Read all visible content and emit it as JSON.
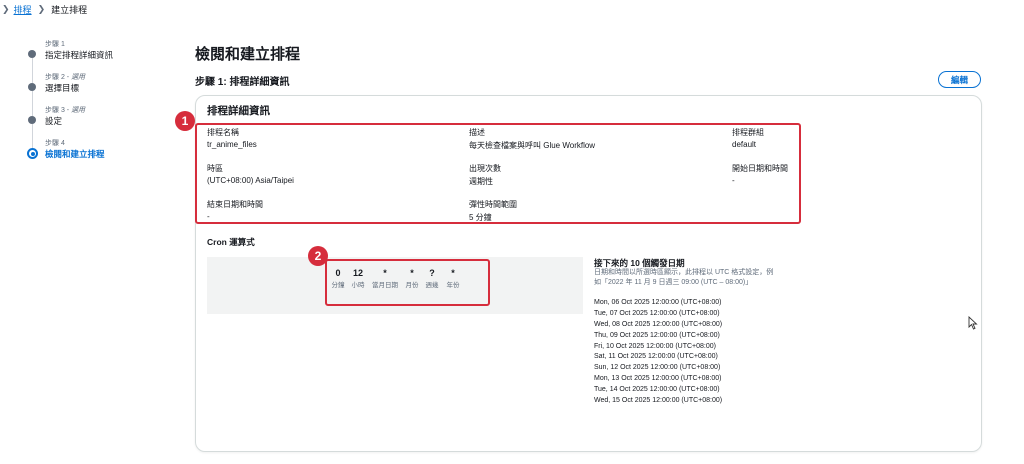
{
  "breadcrumb": {
    "root": "排程",
    "current": "建立排程"
  },
  "steps": [
    {
      "small": "步驟 1",
      "optional": "",
      "label": "指定排程詳細資訊"
    },
    {
      "small": "步驟 2 - ",
      "optional": "選用",
      "label": "選擇目標"
    },
    {
      "small": "步驟 3 - ",
      "optional": "選用",
      "label": "設定"
    },
    {
      "small": "步驟 4",
      "optional": "",
      "label": "檢閱和建立排程"
    }
  ],
  "page_title": "檢閱和建立排程",
  "section_title": "步驟 1: 排程詳細資訊",
  "edit_label": "編輯",
  "card": {
    "title": "排程詳細資訊",
    "fields": {
      "name_label": "排程名稱",
      "name_value": "tr_anime_files",
      "desc_label": "描述",
      "desc_value": "每天檢查檔案與呼叫 Glue Workflow",
      "group_label": "排程群組",
      "group_value": "default",
      "tz_label": "時區",
      "tz_value": "(UTC+08:00) Asia/Taipei",
      "occ_label": "出現次數",
      "occ_value": "週期性",
      "start_label": "開始日期和時間",
      "start_value": "-",
      "end_label": "結束日期和時間",
      "end_value": "-",
      "flex_label": "彈性時間範圍",
      "flex_value": "5 分鐘"
    }
  },
  "annotations": {
    "badge1": "1",
    "badge2": "2",
    "color": "#d62d3c"
  },
  "cron": {
    "title": "Cron 運算式",
    "fields": [
      {
        "value": "0",
        "unit": "分鐘"
      },
      {
        "value": "12",
        "unit": "小時"
      },
      {
        "value": "*",
        "unit": "當月日期"
      },
      {
        "value": "*",
        "unit": "月份"
      },
      {
        "value": "?",
        "unit": "週幾"
      },
      {
        "value": "*",
        "unit": "年份"
      }
    ]
  },
  "next_triggers": {
    "title": "接下來的 10 個觸發日期",
    "desc_line1": "日期和時間以所選時區顯示，此排程以 UTC 格式設定，例",
    "desc_line2": "如「2022 年 11 月 9 日週三 09:00 (UTC – 08:00)」",
    "dates": [
      "Mon, 06 Oct 2025 12:00:00 (UTC+08:00)",
      "Tue, 07 Oct 2025 12:00:00 (UTC+08:00)",
      "Wed, 08 Oct 2025 12:00:00 (UTC+08:00)",
      "Thu, 09 Oct 2025 12:00:00 (UTC+08:00)",
      "Fri, 10 Oct 2025 12:00:00 (UTC+08:00)",
      "Sat, 11 Oct 2025 12:00:00 (UTC+08:00)",
      "Sun, 12 Oct 2025 12:00:00 (UTC+08:00)",
      "Mon, 13 Oct 2025 12:00:00 (UTC+08:00)",
      "Tue, 14 Oct 2025 12:00:00 (UTC+08:00)",
      "Wed, 15 Oct 2025 12:00:00 (UTC+08:00)"
    ]
  },
  "colors": {
    "link": "#0972d3",
    "text": "#16191f",
    "muted": "#5f6b7a",
    "annotation": "#d62d3c"
  }
}
